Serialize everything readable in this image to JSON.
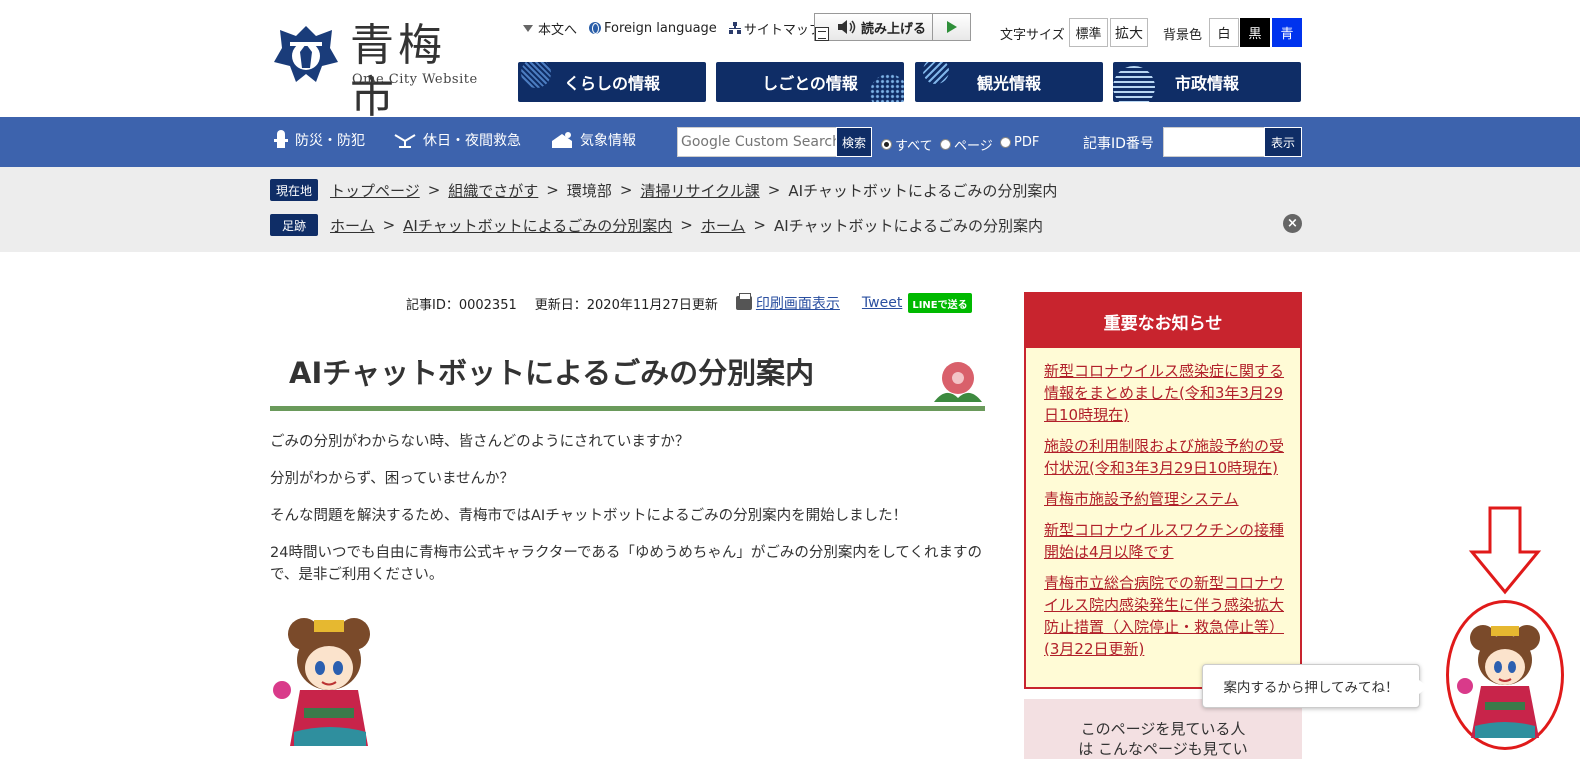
{
  "site": {
    "logo_title": "青梅市",
    "logo_subtitle": "Ome City Website"
  },
  "util": {
    "skip": "本文へ",
    "foreign": "Foreign language",
    "sitemap": "サイトマップ",
    "read_aloud": "読み上げる",
    "fontsize_label": "文字サイズ",
    "fontsize_standard": "標準",
    "fontsize_large": "拡大",
    "bg_label": "背景色",
    "bg_white": "白",
    "bg_black": "黒",
    "bg_blue": "青"
  },
  "gnav": [
    {
      "label": "くらしの情報"
    },
    {
      "label": "しごとの情報"
    },
    {
      "label": "観光情報"
    },
    {
      "label": "市政情報"
    }
  ],
  "bluebar": {
    "disaster": "防災・防犯",
    "emergency": "休日・夜間救急",
    "weather": "気象情報",
    "search_placeholder": "Google Custom Search",
    "search_button": "検索",
    "radio_all": "すべて",
    "radio_page": "ページ",
    "radio_pdf": "PDF",
    "id_label": "記事ID番号",
    "id_button": "表示"
  },
  "breadcrumbs": {
    "current_tag": "現在地",
    "current": [
      "トップページ",
      "組織でさがす",
      "環境部",
      "清掃リサイクル課",
      "AIチャットボットによるごみの分別案内"
    ],
    "history_tag": "足跡",
    "history": [
      "ホーム",
      "AIチャットボットによるごみの分別案内",
      "ホーム",
      "AIチャットボットによるごみの分別案内"
    ]
  },
  "article": {
    "meta_id": "記事ID：0002351",
    "meta_updated": "更新日：2020年11月27日更新",
    "print": "印刷画面表示",
    "tweet": "Tweet",
    "line": "LINEで送る",
    "title": "AIチャットボットによるごみの分別案内",
    "paragraphs": [
      "ごみの分別がわからない時、皆さんどのようにされていますか？",
      "分別がわからず、困っていませんか？",
      "そんな問題を解決するため、青梅市ではAIチャットボットによるごみの分別案内を開始しました！",
      "24時間いつでも自由に青梅市公式キャラクターである「ゆめうめちゃん」がごみの分別案内をしてくれますので、是非ご利用ください。"
    ]
  },
  "notice": {
    "heading": "重要なお知らせ",
    "items": [
      "新型コロナウイルス感染症に関する情報をまとめました(令和3年3月29日10時現在)",
      "施設の利用制限および施設予約の受付状況(令和3年3月29日10時現在)",
      "青梅市施設予約管理システム",
      "新型コロナウイルスワクチンの接種開始は4月以降です",
      "青梅市立総合病院での新型コロナウイルス院内感染発生に伴う感染拡大防止措置（入院停止・救急停止等）(3月22日更新)"
    ]
  },
  "popular": {
    "text": "このページを見ている人は こんなページも見ています"
  },
  "chatbot": {
    "bubble": "案内するから押してみてね！"
  },
  "colors": {
    "navy": "#0f2d66",
    "bar_blue": "#3d63ad",
    "notice_red": "#c8242e",
    "title_green": "#6a9a5b",
    "annotation_red": "#e01a1a"
  }
}
